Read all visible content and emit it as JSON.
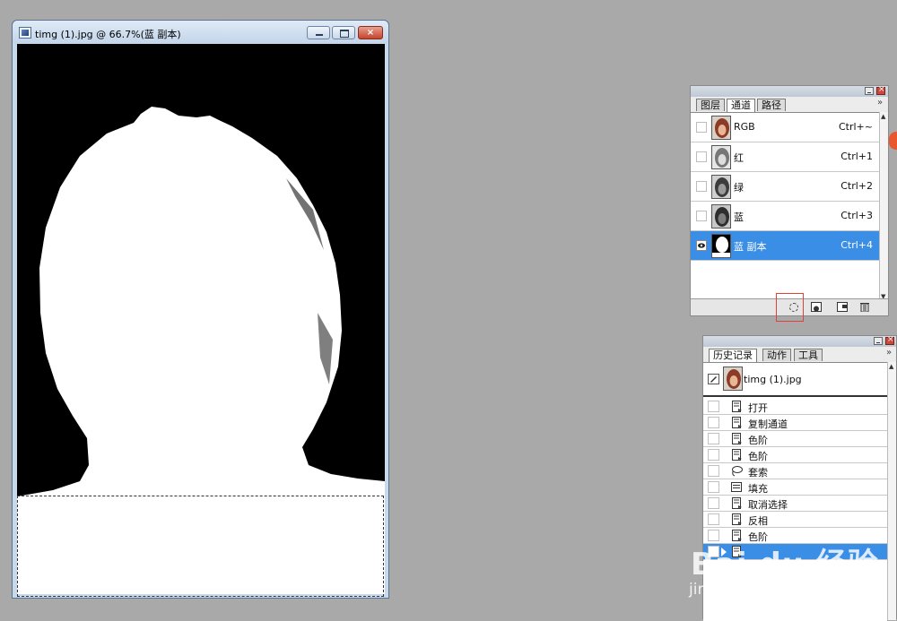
{
  "document": {
    "title": "timg (1).jpg @ 66.7%(蓝 副本)",
    "close_glyph": "×"
  },
  "channels_panel": {
    "tabs": [
      "图层",
      "通道",
      "路径"
    ],
    "active_tab": "通道",
    "menu_arrow": "»",
    "channels": [
      {
        "name": "RGB",
        "shortcut": "Ctrl+~",
        "visible": false,
        "selected": false
      },
      {
        "name": "红",
        "shortcut": "Ctrl+1",
        "visible": false,
        "selected": false
      },
      {
        "name": "绿",
        "shortcut": "Ctrl+2",
        "visible": false,
        "selected": false
      },
      {
        "name": "蓝",
        "shortcut": "Ctrl+3",
        "visible": false,
        "selected": false
      },
      {
        "name": "蓝 副本",
        "shortcut": "Ctrl+4",
        "visible": true,
        "selected": true
      }
    ]
  },
  "history_panel": {
    "tabs": [
      "历史记录",
      "动作",
      "工具"
    ],
    "active_tab": "历史记录",
    "menu_arrow": "»",
    "snapshot": "timg (1).jpg",
    "steps": [
      {
        "label": "打开",
        "icon": "history-step-icon"
      },
      {
        "label": "复制通道",
        "icon": "history-step-icon"
      },
      {
        "label": "色阶",
        "icon": "history-step-icon"
      },
      {
        "label": "色阶",
        "icon": "history-step-icon"
      },
      {
        "label": "套索",
        "icon": "lasso-icon"
      },
      {
        "label": "填充",
        "icon": "fill-icon"
      },
      {
        "label": "取消选择",
        "icon": "history-step-icon"
      },
      {
        "label": "反相",
        "icon": "history-step-icon"
      },
      {
        "label": "色阶",
        "icon": "history-step-icon"
      },
      {
        "label": "",
        "icon": "history-step-icon",
        "selected": true
      }
    ]
  },
  "watermark": {
    "main": "Bai du 经验",
    "sub": "jingyan.baidu.com"
  },
  "colors": {
    "selected_row": "#3a8ee6",
    "highlight_box": "#e0413a",
    "workspace": "#a9a9a9"
  }
}
